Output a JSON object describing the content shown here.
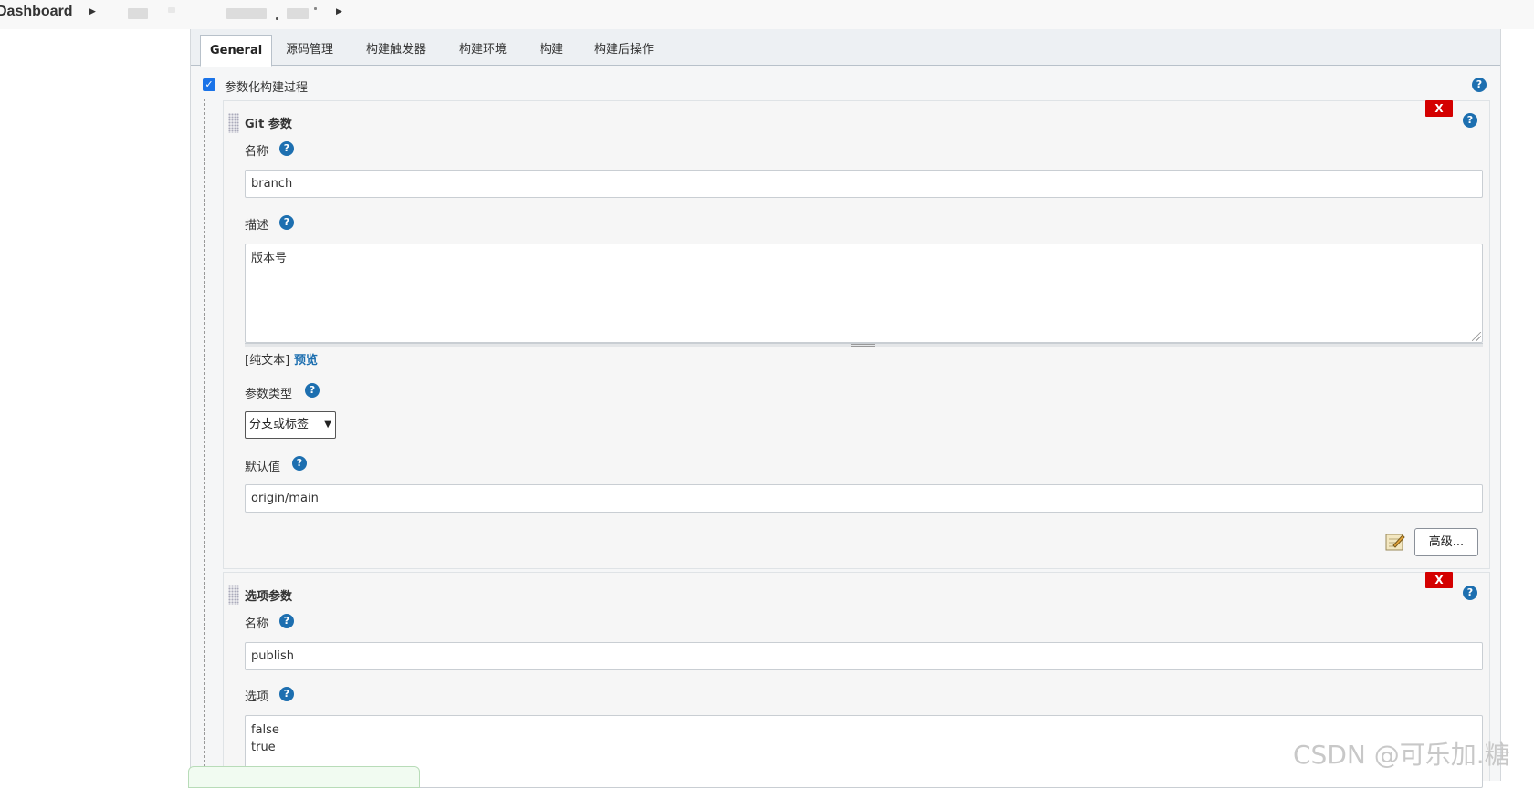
{
  "breadcrumb": {
    "dashboard": "Dashboard",
    "separator_icon": "caret-right-icon"
  },
  "tabs": [
    {
      "label": "General",
      "active": true
    },
    {
      "label": "源码管理"
    },
    {
      "label": "构建触发器"
    },
    {
      "label": "构建环境"
    },
    {
      "label": "构建"
    },
    {
      "label": "构建后操作"
    }
  ],
  "parameterized": {
    "checked": true,
    "label": "参数化构建过程"
  },
  "git_param": {
    "title": "Git 参数",
    "delete_label": "X",
    "name_label": "名称",
    "name_value": "branch",
    "desc_label": "描述",
    "desc_value": "版本号",
    "format_plain": "[纯文本]",
    "format_preview": "预览",
    "type_label": "参数类型",
    "type_value": "分支或标签",
    "default_label": "默认值",
    "default_value": "origin/main",
    "advanced_label": "高级..."
  },
  "choice_param": {
    "title": "选项参数",
    "delete_label": "X",
    "name_label": "名称",
    "name_value": "publish",
    "choices_label": "选项",
    "choices_value": "false\ntrue"
  },
  "help_glyph": "?",
  "watermark": "CSDN @可乐加.糖",
  "colors": {
    "help": "#1d6fb0",
    "delete": "#d40000",
    "checkbox": "#1a73e8",
    "link": "#1d6fb0"
  }
}
